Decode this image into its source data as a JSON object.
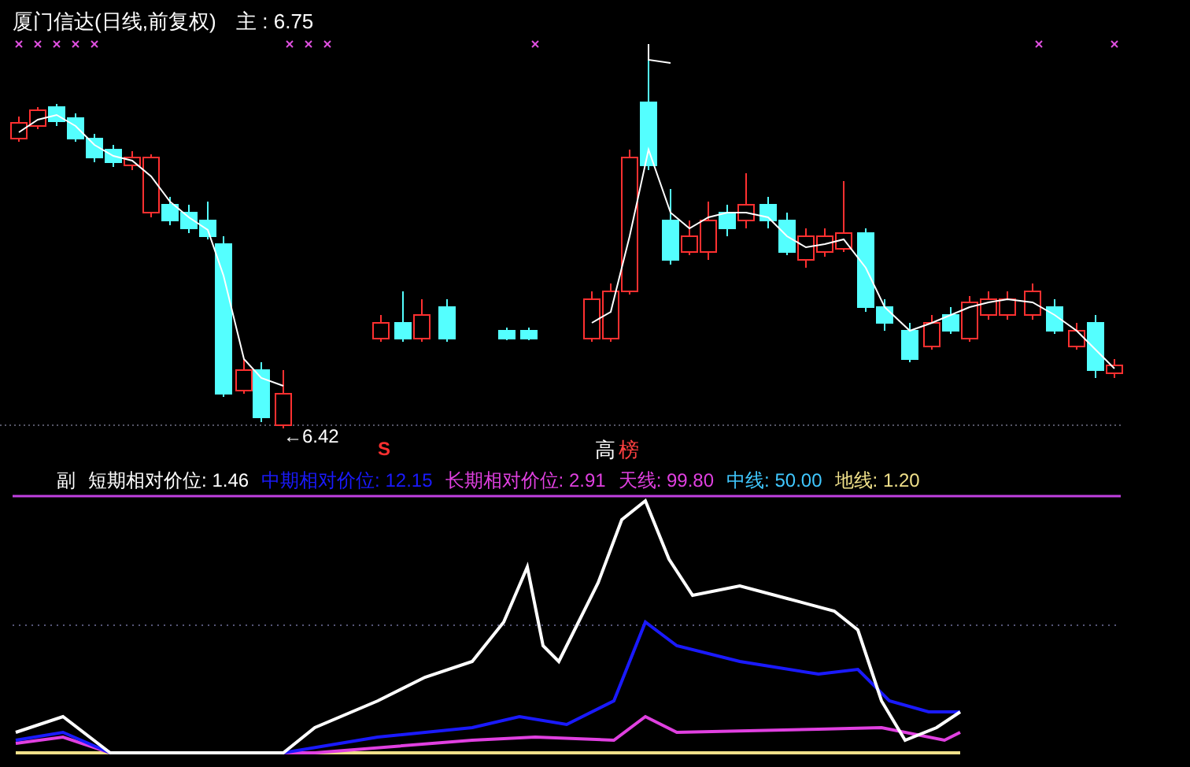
{
  "title": "厦门信达(日线,前复权)",
  "main": {
    "label": "主 :",
    "value": "6.75"
  },
  "low_label": "←6.42",
  "signal_mark": "S",
  "top_labels": [
    {
      "text": "高",
      "color": "#ffffff"
    },
    {
      "text": "榜",
      "color": "#ff4040"
    }
  ],
  "indicator": {
    "prefix": "副",
    "items": [
      {
        "label": "短期相对价位:",
        "value": "1.46",
        "color": "#ffffff"
      },
      {
        "label": "中期相对价位:",
        "value": "12.15",
        "color": "#1a1aff"
      },
      {
        "label": "长期相对价位:",
        "value": "2.91",
        "color": "#e040e0"
      },
      {
        "label": "天线:",
        "value": "99.80",
        "color": "#e040e0"
      },
      {
        "label": "中线:",
        "value": "50.00",
        "color": "#40c8ff"
      },
      {
        "label": "地线:",
        "value": "1.20",
        "color": "#f0e08a"
      }
    ]
  }
}
